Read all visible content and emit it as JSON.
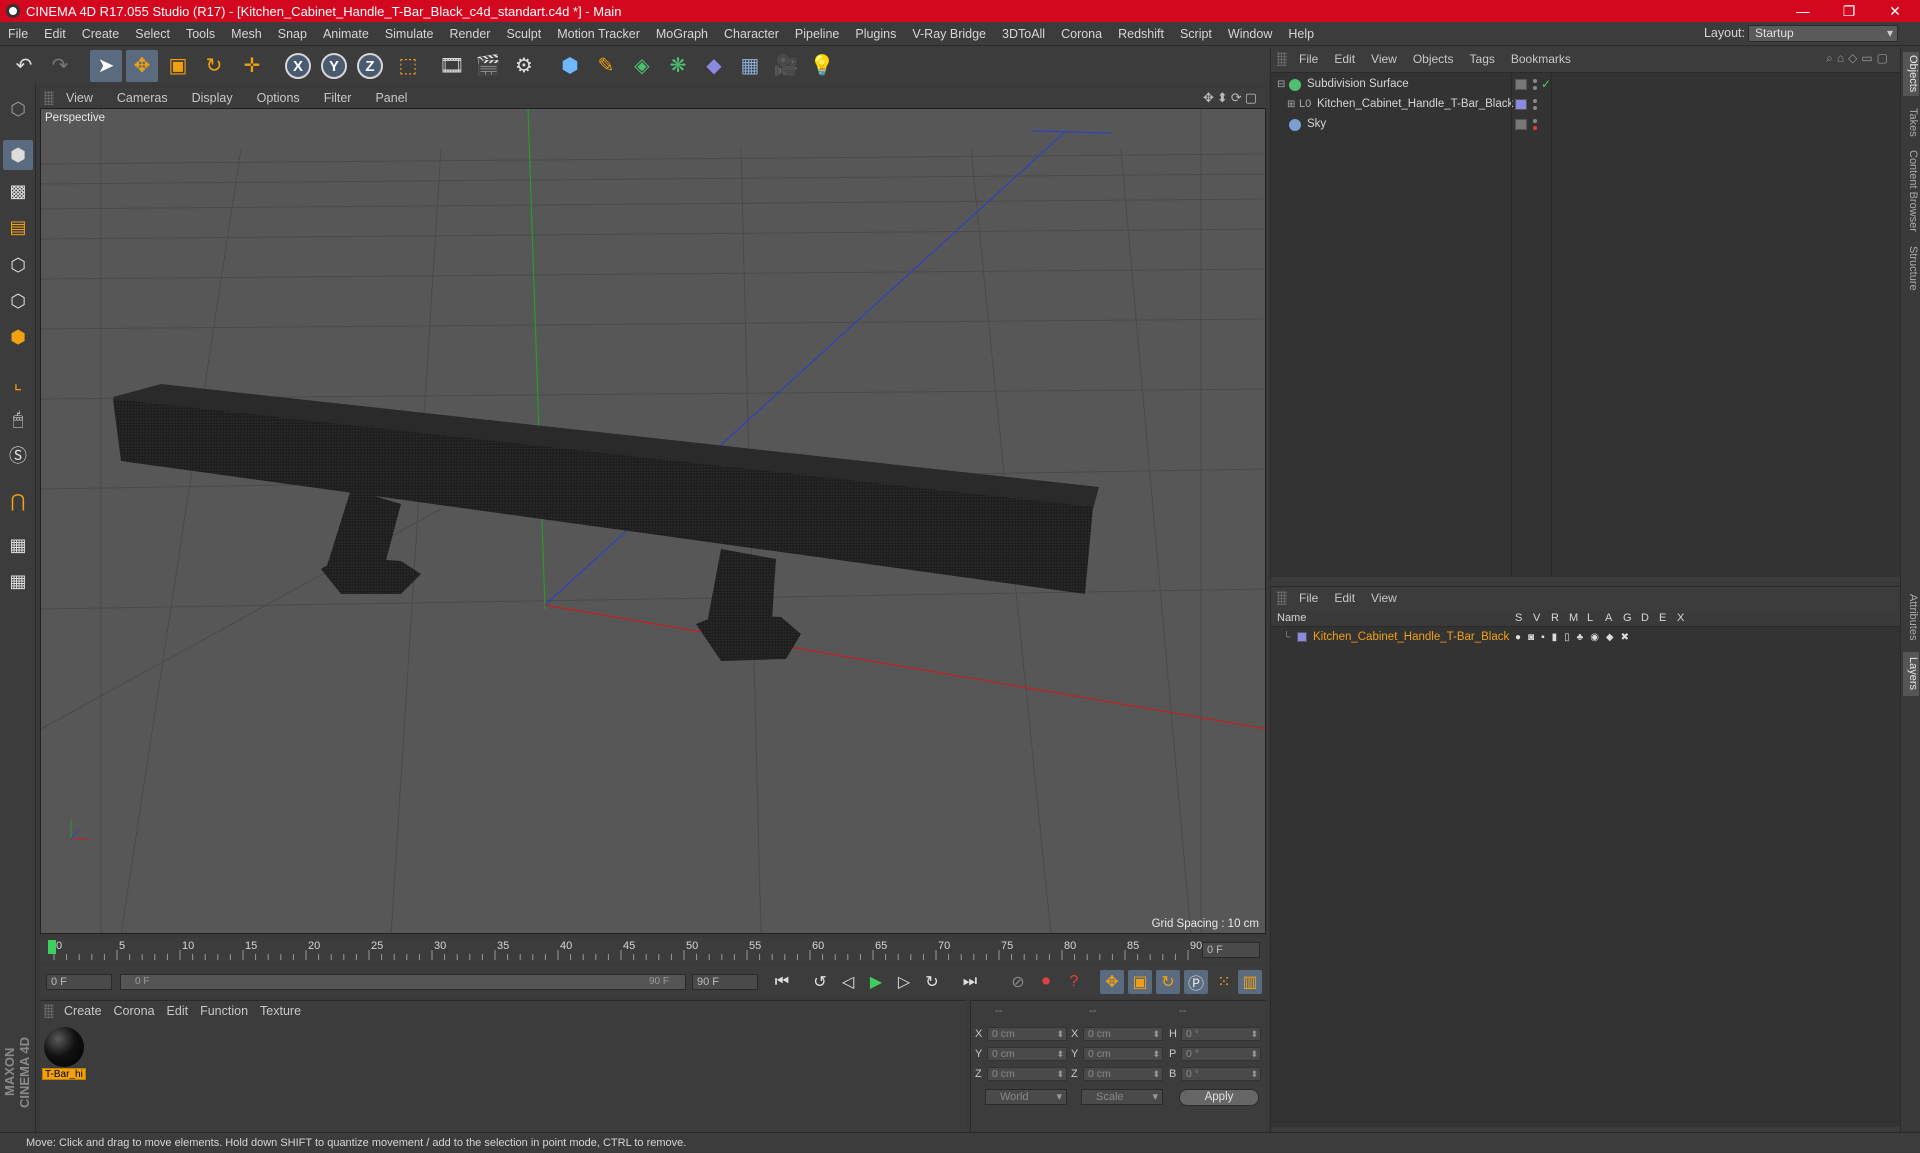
{
  "window": {
    "title": "CINEMA 4D R17.055 Studio (R17) - [Kitchen_Cabinet_Handle_T-Bar_Black_c4d_standart.c4d *] - Main",
    "minimize": "—",
    "maximize": "❐",
    "close": "✕"
  },
  "menubar": {
    "items": [
      "File",
      "Edit",
      "Create",
      "Select",
      "Tools",
      "Mesh",
      "Snap",
      "Animate",
      "Simulate",
      "Render",
      "Sculpt",
      "Motion Tracker",
      "MoGraph",
      "Character",
      "Pipeline",
      "Plugins",
      "V-Ray Bridge",
      "3DToAll",
      "Corona",
      "Redshift",
      "Script",
      "Window",
      "Help"
    ],
    "layout_label": "Layout:",
    "layout_value": "Startup"
  },
  "toolbar": {
    "icons": [
      "undo-icon",
      "redo-icon",
      "live-selection-icon",
      "move-icon",
      "scale-icon",
      "rotate-icon",
      "last-tool-icon",
      "x-axis-icon",
      "y-axis-icon",
      "z-axis-icon",
      "coordinate-system-icon",
      "render-view-icon",
      "render-picture-viewer-icon",
      "edit-render-settings-icon",
      "cube-icon",
      "pen-spline-icon",
      "subdivision-surface-icon",
      "cloner-icon",
      "deformer-icon",
      "floor-icon",
      "camera-icon",
      "light-icon"
    ],
    "axis_x": "X",
    "axis_y": "Y",
    "axis_z": "Z"
  },
  "viewport": {
    "menu": [
      "View",
      "Cameras",
      "Display",
      "Options",
      "Filter",
      "Panel"
    ],
    "label": "Perspective",
    "grid_spacing": "Grid Spacing : 10 cm"
  },
  "timeline": {
    "ticks": [
      "0",
      "5",
      "10",
      "15",
      "20",
      "25",
      "30",
      "35",
      "40",
      "45",
      "50",
      "55",
      "60",
      "65",
      "70",
      "75",
      "80",
      "85",
      "90"
    ],
    "current_frame": "0 F",
    "start_field": "0 F",
    "range_start": "0 F",
    "range_end": "90 F",
    "end_field": "90 F"
  },
  "material_manager": {
    "menu": [
      "Create",
      "Corona",
      "Edit",
      "Function",
      "Texture"
    ],
    "material_name": "T-Bar_hi"
  },
  "coordinates": {
    "header": [
      "--",
      "--",
      "--"
    ],
    "rows": [
      {
        "l1": "X",
        "v1": "0 cm",
        "l2": "X",
        "v2": "0 cm",
        "l3": "H",
        "v3": "0 °"
      },
      {
        "l1": "Y",
        "v1": "0 cm",
        "l2": "Y",
        "v2": "0 cm",
        "l3": "P",
        "v3": "0 °"
      },
      {
        "l1": "Z",
        "v1": "0 cm",
        "l2": "Z",
        "v2": "0 cm",
        "l3": "B",
        "v3": "0 °"
      }
    ],
    "mode": "World",
    "transform": "Scale",
    "apply": "Apply"
  },
  "object_manager": {
    "menu": [
      "File",
      "Edit",
      "View",
      "Objects",
      "Tags",
      "Bookmarks"
    ],
    "objects": [
      {
        "name": "Subdivision Surface",
        "color": "#4fbf6f"
      },
      {
        "name": "Kitchen_Cabinet_Handle_T-Bar_Black",
        "color": "#8a8ae0"
      },
      {
        "name": "Sky",
        "color": "#7aa0d0"
      }
    ]
  },
  "layer_manager": {
    "menu": [
      "File",
      "Edit",
      "View"
    ],
    "columns": [
      "Name",
      "S",
      "V",
      "R",
      "M",
      "L",
      "A",
      "G",
      "D",
      "E",
      "X"
    ],
    "layer": "Kitchen_Cabinet_Handle_T-Bar_Black"
  },
  "right_tabs": [
    "Objects",
    "Takes",
    "Content Browser",
    "Structure",
    "Attributes",
    "Layers"
  ],
  "status": "Move: Click and drag to move elements. Hold down SHIFT to quantize movement / add to the selection in point mode, CTRL to remove.",
  "maxon_logo": "MAXON CINEMA 4D",
  "colors": {
    "title_bar": "#d3081f",
    "accent_orange": "#f0a010",
    "active_tool": "#5a6b80"
  }
}
